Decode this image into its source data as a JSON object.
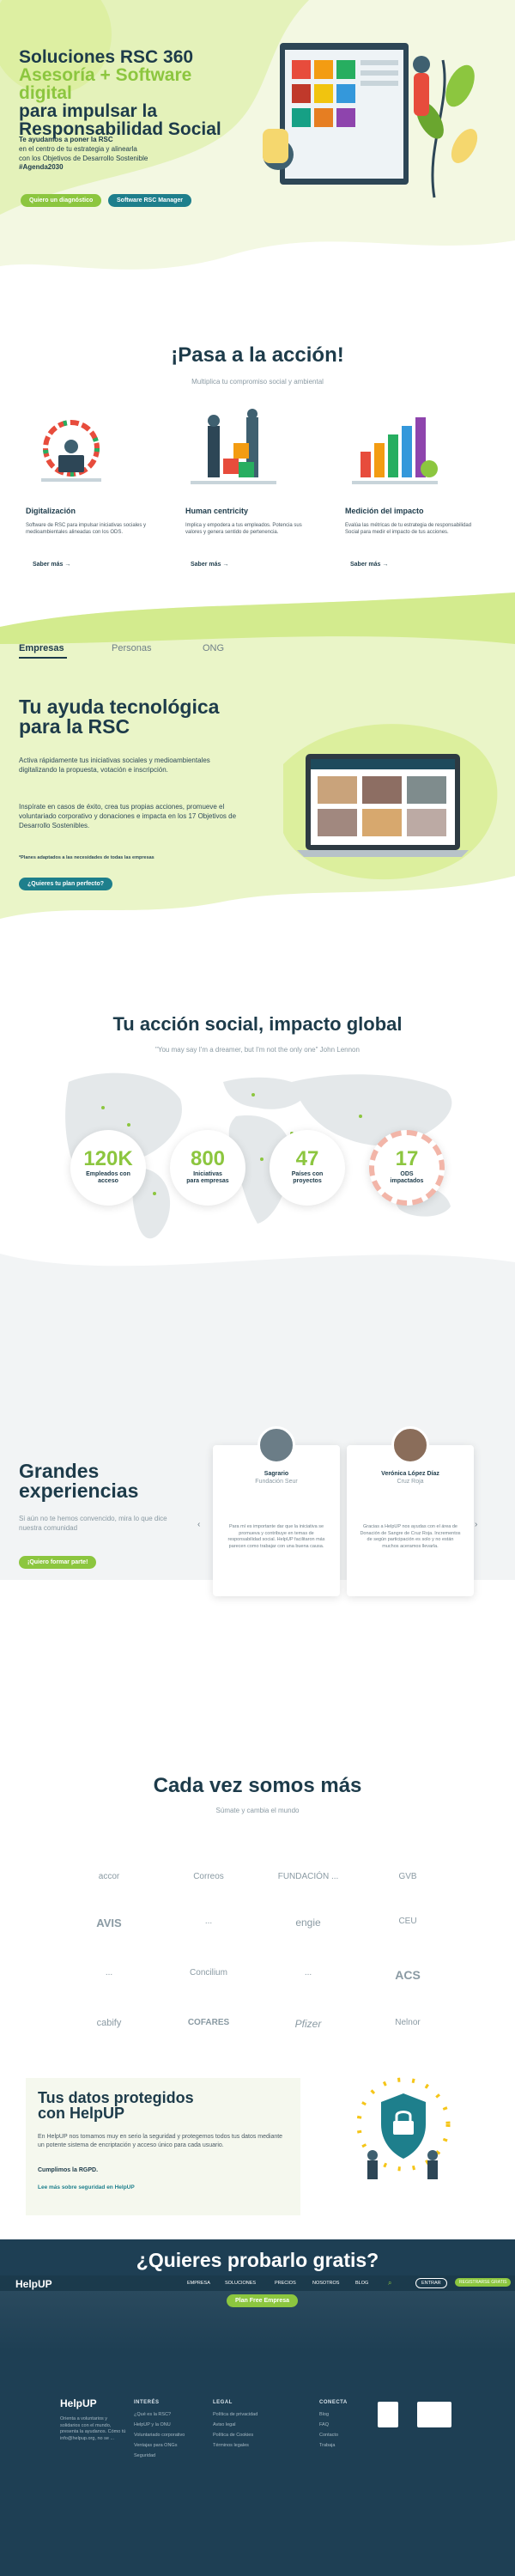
{
  "hero": {
    "title_line1": "Soluciones RSC 360",
    "title_line2": "Asesoría + Software digital",
    "title_line3": "para impulsar la",
    "title_line4": "Responsabilidad Social",
    "desc_bold": "Te ayudamos a poner la RSC",
    "desc_line2": "en el centro de tu estrategia y alinearla",
    "desc_line3": "con los Objetivos de Desarrollo Sostenible",
    "desc_tag": "#Agenda2030",
    "btn_diagnostico": "Quiero un diagnóstico",
    "btn_software": "Software RSC Manager"
  },
  "accion": {
    "title": "¡Pasa a la acción!",
    "subtitle": "Multiplica tu compromiso social y ambiental",
    "cards": [
      {
        "title": "Digitalización",
        "text": "Software de RSC para impulsar iniciativas sociales y medioambientales alineadas con los ODS.",
        "link": "Saber más →"
      },
      {
        "title": "Human centricity",
        "text": "Implica y empodera a tus empleados. Potencia sus valores y genera sentido de pertenencia.",
        "link": "Saber más →"
      },
      {
        "title": "Medición del impacto",
        "text": "Evalúa las métricas de tu estrategia de responsabilidad Social para medir el impacto de tus acciones.",
        "link": "Saber más →"
      }
    ]
  },
  "tabs": [
    "Empresas",
    "Personas",
    "ONG"
  ],
  "ayuda": {
    "title_line1": "Tu ayuda tecnológica",
    "title_line2": "para la RSC",
    "p1": "Activa rápidamente tus iniciativas sociales y medioambientales digitalizando la propuesta, votación e inscripción.",
    "p2": "Inspírate en casos de éxito, crea tus propias acciones, promueve el voluntariado corporativo y donaciones e impacta en los 17 Objetivos de Desarrollo Sostenibles.",
    "note": "*Planes adaptados a las necesidades de todas las empresas",
    "button": "¿Quieres tu plan perfecto?"
  },
  "impacto": {
    "title": "Tu acción social, impacto global",
    "quote": "\"You may say I'm a dreamer, but I'm not the only one\" John Lennon",
    "stats": [
      {
        "value": "120K",
        "label1": "Empleados con",
        "label2": "acceso"
      },
      {
        "value": "800",
        "label1": "Iniciativas",
        "label2": "para empresas"
      },
      {
        "value": "47",
        "label1": "Países con",
        "label2": "proyectos"
      },
      {
        "value": "17",
        "label1": "ODS",
        "label2": "impactados"
      }
    ]
  },
  "experiencias": {
    "title_line1": "Grandes",
    "title_line2": "experiencias",
    "desc": "Si aún no te hemos convencido, mira lo que dice nuestra comunidad",
    "button": "¡Quiero formar parte!",
    "testimonials": [
      {
        "name": "Sagrario",
        "org": "Fundación Seur",
        "text": "Para mí es importante dar que la iniciativa se promueva y contribuye en temas de responsabilidad social. HelpUP facilitaron más parecen como trabajar con una buena causa."
      },
      {
        "name": "Verónica López Díaz",
        "org": "Cruz Roja",
        "text": "Gracias a HelpUP nos ayudas con el área de Donación de Sangre de Cruz Roja. Incrementos de según participación es solo y no están muchos aceramos llevarla."
      }
    ]
  },
  "clientes": {
    "title": "Cada vez somos más",
    "subtitle": "Súmate y cambia el mundo",
    "logos": [
      "accor",
      "Correos",
      "FUNDACIÓN ...",
      "GVB",
      "AVIS",
      "...",
      "engie",
      "CEU",
      "...",
      "Concilium",
      "...",
      "ACS",
      "cabify",
      "COFARES",
      "Pfizer",
      "Nelnor"
    ]
  },
  "proteccion": {
    "title_line1": "Tus datos protegidos",
    "title_line2": "con HelpUP",
    "text": "En HelpUP nos tomamos muy en serio la seguridad y protegemos todos tus datos mediante un potente sistema de encriptación y acceso único para cada usuario.",
    "rgpd_line": "Cumplimos la RGPD.",
    "link": "Lee más sobre seguridad en HelpUP",
    "badge": "RGPD"
  },
  "probar": {
    "title": "¿Quieres probarlo gratis?",
    "button": "Plan Free Empresa"
  },
  "navbar": {
    "logo": "HelpUP",
    "items": [
      "EMPRESA",
      "SOLUCIONES",
      "PRECIOS",
      "NOSOTROS",
      "BLOG"
    ],
    "login": "ENTRAR",
    "cta": "REGISTRARSE GRATIS"
  },
  "footer": {
    "logo": "HelpUP",
    "about": "Orienta a voluntarios y solidarios con el mundo, presenta la ayudanos. Cómo tú info@helpup.org, no se ...",
    "cols": [
      {
        "title": "INTERÉS",
        "links": [
          "¿Qué es la RSC?",
          "HelpUP y la ONU",
          "Voluntariado corporativo",
          "Ventajas para ONGs",
          "Seguridad"
        ]
      },
      {
        "title": "LEGAL",
        "links": [
          "Política de privacidad",
          "Aviso legal",
          "Política de Cookies",
          "Términos legales"
        ]
      },
      {
        "title": "CONECTA",
        "links": [
          "Blog",
          "FAQ",
          "Contacto",
          "Trabaja"
        ]
      }
    ]
  },
  "colors": {
    "brand_green": "#8cc63f",
    "navy": "#1d3b4a",
    "teal": "#1e7f8c",
    "footer": "#1e3f54"
  }
}
